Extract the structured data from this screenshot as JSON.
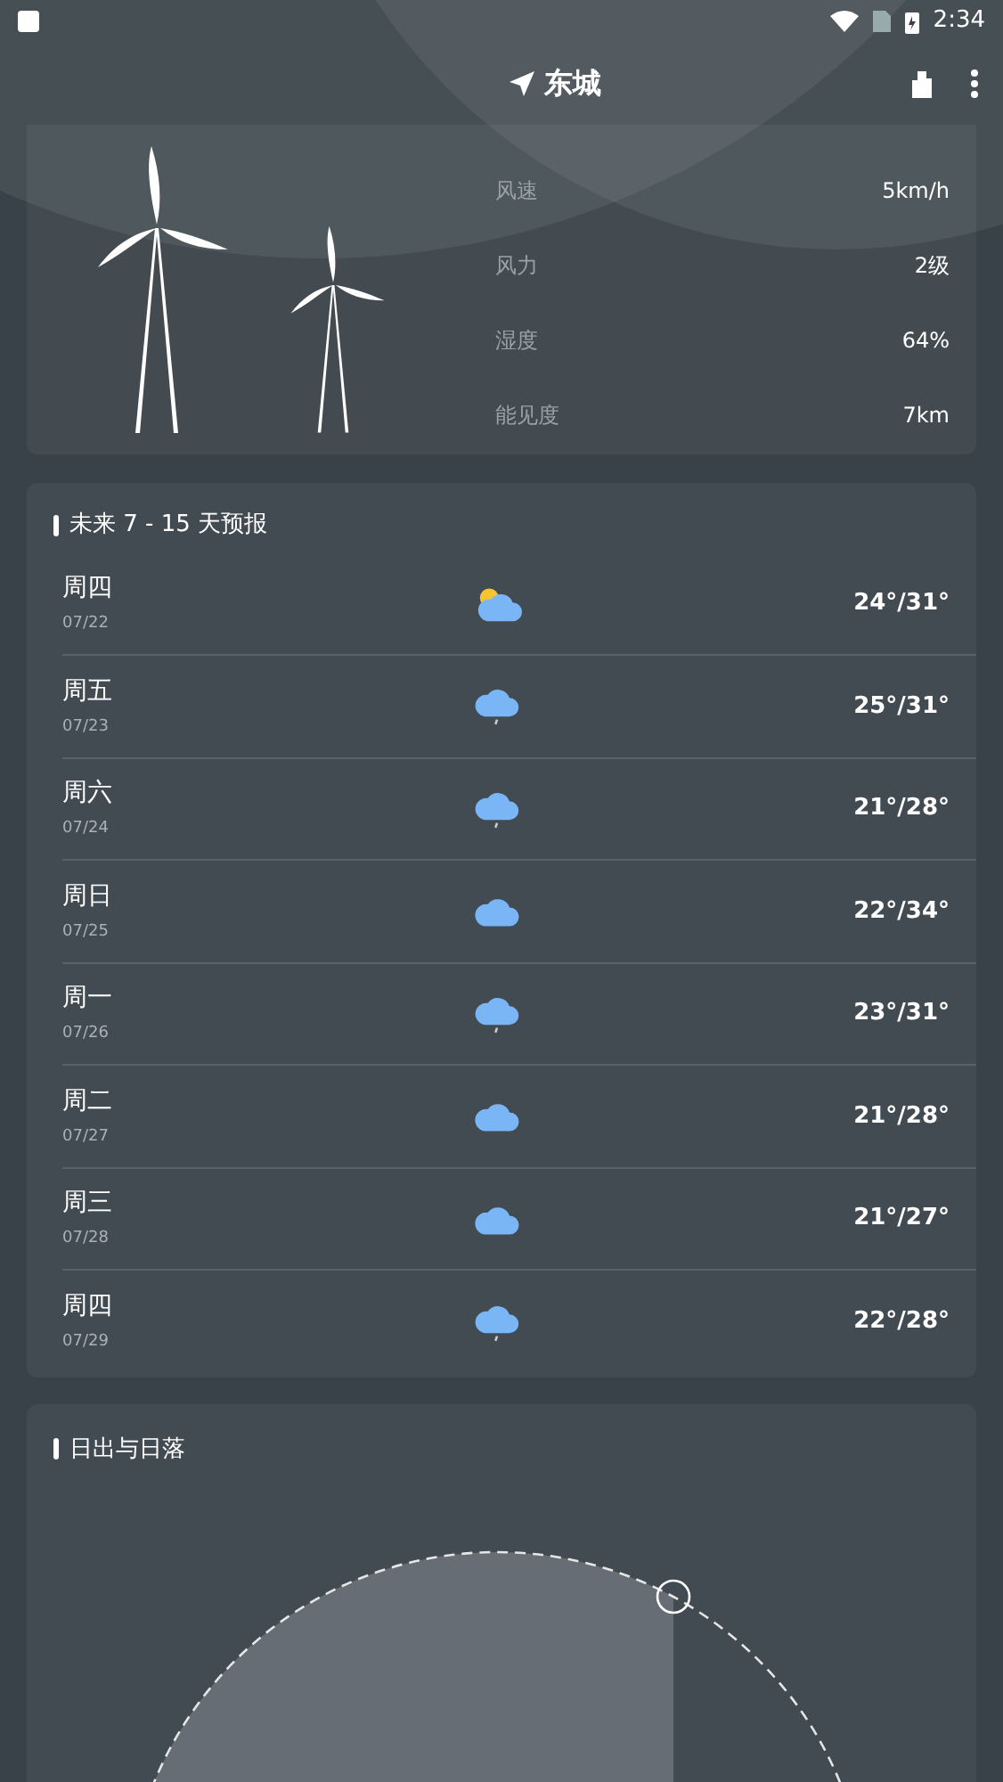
{
  "status_bar": {
    "time": "2:34"
  },
  "header": {
    "title": "东城"
  },
  "wind_card": {
    "rows": [
      {
        "label": "风速",
        "value": "5km/h"
      },
      {
        "label": "风力",
        "value": "2级"
      },
      {
        "label": "湿度",
        "value": "64%"
      },
      {
        "label": "能见度",
        "value": "7km"
      }
    ]
  },
  "forecast": {
    "title": "未来 7 - 15 天预报",
    "days": [
      {
        "day": "周四",
        "date": "07/22",
        "kind": "partly_cloudy",
        "temp": "24°/31°"
      },
      {
        "day": "周五",
        "date": "07/23",
        "kind": "rain",
        "temp": "25°/31°"
      },
      {
        "day": "周六",
        "date": "07/24",
        "kind": "rain",
        "temp": "21°/28°"
      },
      {
        "day": "周日",
        "date": "07/25",
        "kind": "cloudy",
        "temp": "22°/34°"
      },
      {
        "day": "周一",
        "date": "07/26",
        "kind": "rain",
        "temp": "23°/31°"
      },
      {
        "day": "周二",
        "date": "07/27",
        "kind": "cloudy",
        "temp": "21°/28°"
      },
      {
        "day": "周三",
        "date": "07/28",
        "kind": "cloudy",
        "temp": "21°/27°"
      },
      {
        "day": "周四",
        "date": "07/29",
        "kind": "rain",
        "temp": "22°/28°"
      }
    ]
  },
  "sun": {
    "title": "日出与日落"
  }
}
